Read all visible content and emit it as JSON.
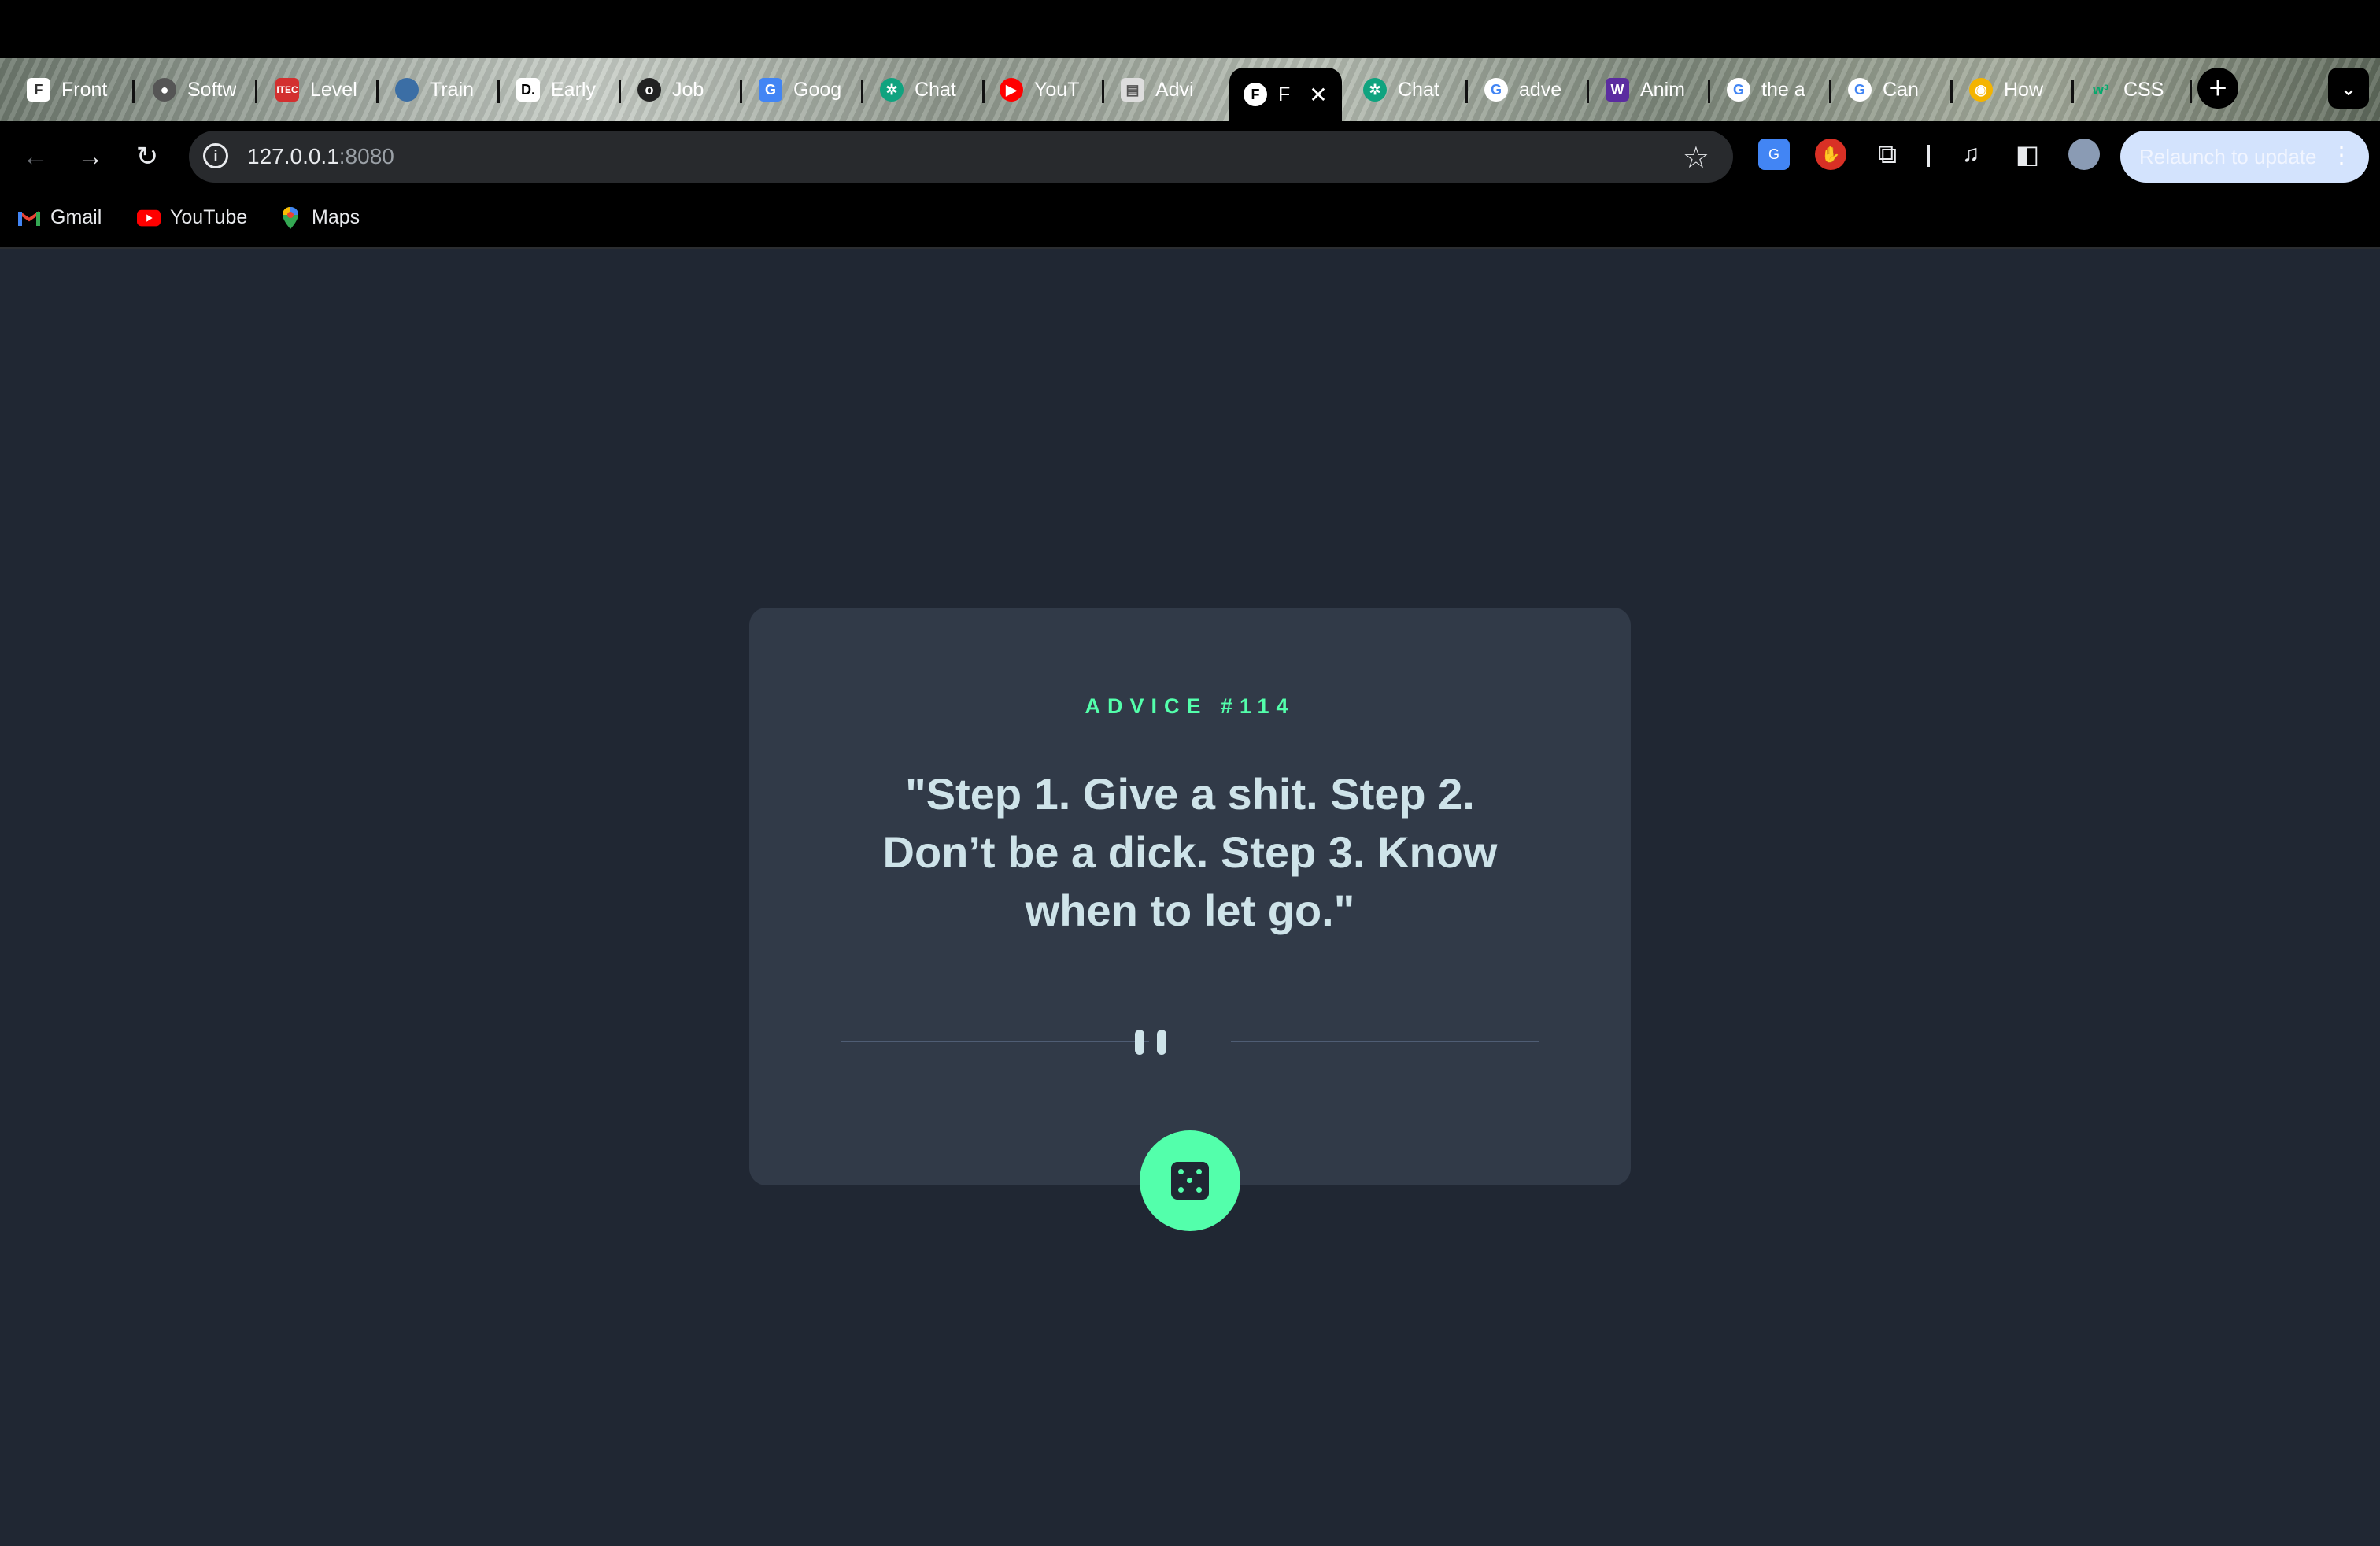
{
  "tabs": [
    {
      "title": "Front",
      "icon": "frontend-mentor-icon",
      "color": "#ffffff"
    },
    {
      "title": "Softw",
      "icon": "software-icon",
      "color": "#c0392b"
    },
    {
      "title": "Level",
      "icon": "level-icon",
      "color": "#d32f2f"
    },
    {
      "title": "Train",
      "icon": "train-icon",
      "color": "#3b6ea5"
    },
    {
      "title": "Early",
      "icon": "dev-icon",
      "color": "#ffffff"
    },
    {
      "title": "Job",
      "icon": "job-icon",
      "color": "#222222"
    },
    {
      "title": "Goog",
      "icon": "google-translate-icon",
      "color": "#4285f4"
    },
    {
      "title": "Chat",
      "icon": "chatgpt-icon",
      "color": "#10a37f"
    },
    {
      "title": "YouT",
      "icon": "youtube-icon",
      "color": "#ff0000"
    },
    {
      "title": "Advi",
      "icon": "advice-icon",
      "color": "#dddddd"
    }
  ],
  "active_tab": {
    "title": "F",
    "icon": "frontend-mentor-icon"
  },
  "tabs_right": [
    {
      "title": "Chat",
      "icon": "chatgpt-icon",
      "color": "#10a37f"
    },
    {
      "title": "adve",
      "icon": "google-icon",
      "color": "#ffffff"
    },
    {
      "title": "Anim",
      "icon": "w-icon",
      "color": "#5b2ca0"
    },
    {
      "title": "the a",
      "icon": "google-icon",
      "color": "#ffffff"
    },
    {
      "title": "Can",
      "icon": "google-icon",
      "color": "#ffffff"
    },
    {
      "title": "How",
      "icon": "chrome-icon",
      "color": "#f4b400"
    },
    {
      "title": "CSS",
      "icon": "w3-icon",
      "color": "#04aa6d"
    }
  ],
  "address": {
    "host": "127.0.0.1",
    "port": ":8080"
  },
  "relaunch_label": "Relaunch to update",
  "bookmarks": [
    {
      "label": "Gmail",
      "icon": "gmail-icon"
    },
    {
      "label": "YouTube",
      "icon": "youtube-icon"
    },
    {
      "label": "Maps",
      "icon": "maps-icon"
    }
  ],
  "advice": {
    "id_label": "ADVICE #114",
    "quote": "\"Step 1. Give a shit. Step 2. Don’t be a dick. Step 3. Know when to let go.\""
  },
  "colors": {
    "accent": "#53ffab",
    "card": "#313a48",
    "background": "#202733",
    "text": "#cee3e9"
  }
}
